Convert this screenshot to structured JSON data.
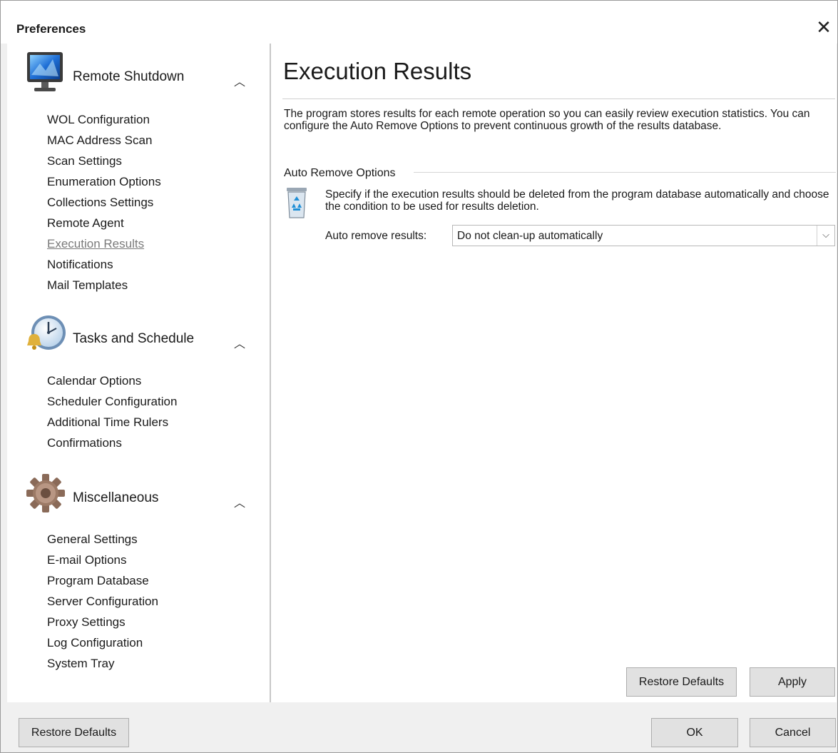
{
  "window": {
    "title": "Preferences"
  },
  "sidebar": {
    "groups": [
      {
        "title": "Remote Shutdown",
        "icon": "monitor-icon",
        "items": [
          "WOL Configuration",
          "MAC Address Scan",
          "Scan Settings",
          "Enumeration Options",
          "Collections Settings",
          "Remote Agent",
          "Execution Results",
          "Notifications",
          "Mail Templates"
        ]
      },
      {
        "title": "Tasks and Schedule",
        "icon": "clock-icon",
        "items": [
          "Calendar Options",
          "Scheduler Configuration",
          "Additional Time Rulers",
          "Confirmations"
        ]
      },
      {
        "title": "Miscellaneous",
        "icon": "gear-icon",
        "items": [
          "General Settings",
          "E-mail Options",
          "Program Database",
          "Server Configuration",
          "Proxy Settings",
          "Log Configuration",
          "System Tray"
        ]
      }
    ],
    "active_item": "Execution Results"
  },
  "content": {
    "heading": "Execution Results",
    "description": "The program stores results for each remote operation so you can easily review execution statistics. You can configure the Auto Remove Options to prevent continuous growth of the results database.",
    "section_label": "Auto Remove Options",
    "option_description": "Specify if the execution results should be deleted from the program database automatically and choose the condition to be used for results deletion.",
    "auto_remove_label": "Auto remove results:",
    "auto_remove_value": "Do not clean-up automatically",
    "restore_defaults_label": "Restore Defaults",
    "apply_label": "Apply"
  },
  "footer": {
    "restore_defaults_label": "Restore Defaults",
    "ok_label": "OK",
    "cancel_label": "Cancel"
  }
}
